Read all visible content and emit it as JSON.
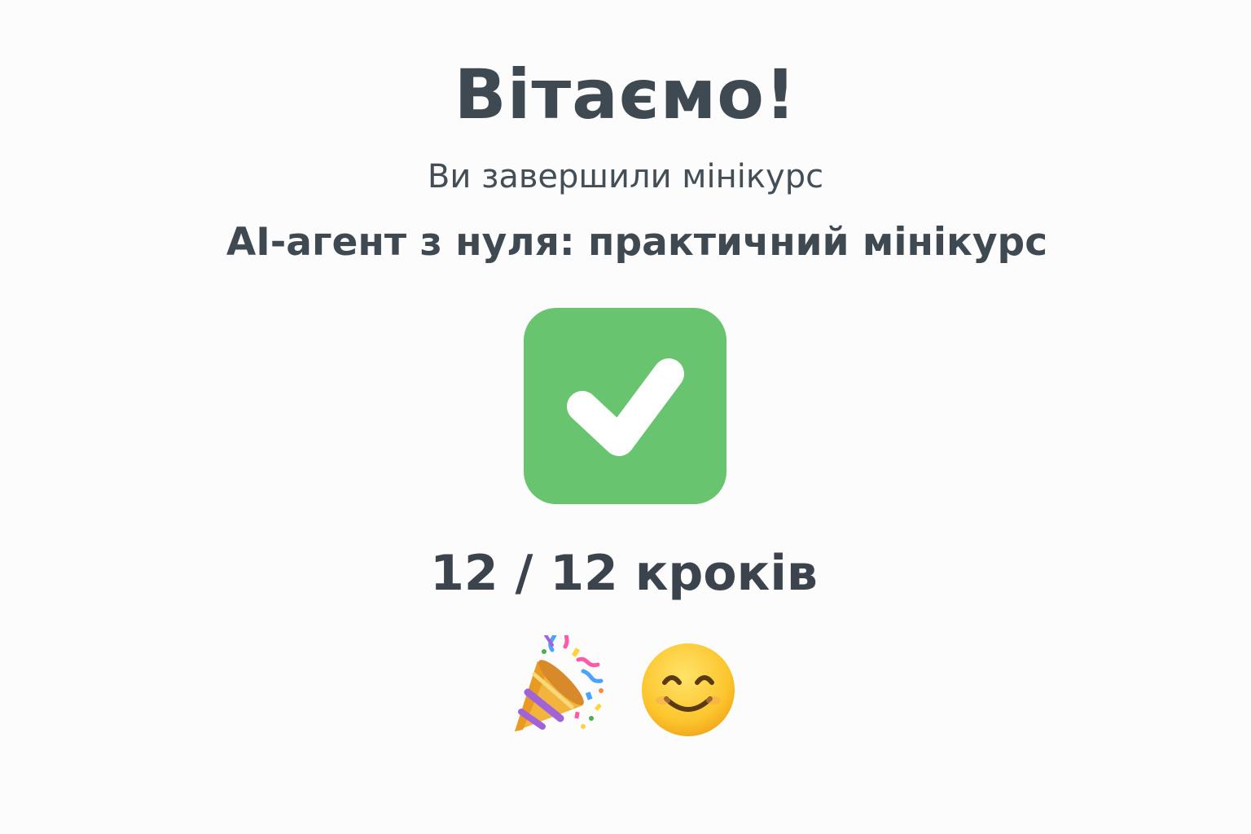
{
  "congrats": {
    "title": "Вітаємо!",
    "subtitle": "Ви завершили мінікурс",
    "course_name": "AI-агент з нуля: практичний мінікурс"
  },
  "status": {
    "icon": "check-mark-icon",
    "color": "#68c46f",
    "completed_steps": 12,
    "total_steps": 12,
    "steps_label": "12 / 12 кроків"
  },
  "emojis": [
    {
      "icon": "party-popper-icon"
    },
    {
      "icon": "smiling-face-icon"
    }
  ]
}
